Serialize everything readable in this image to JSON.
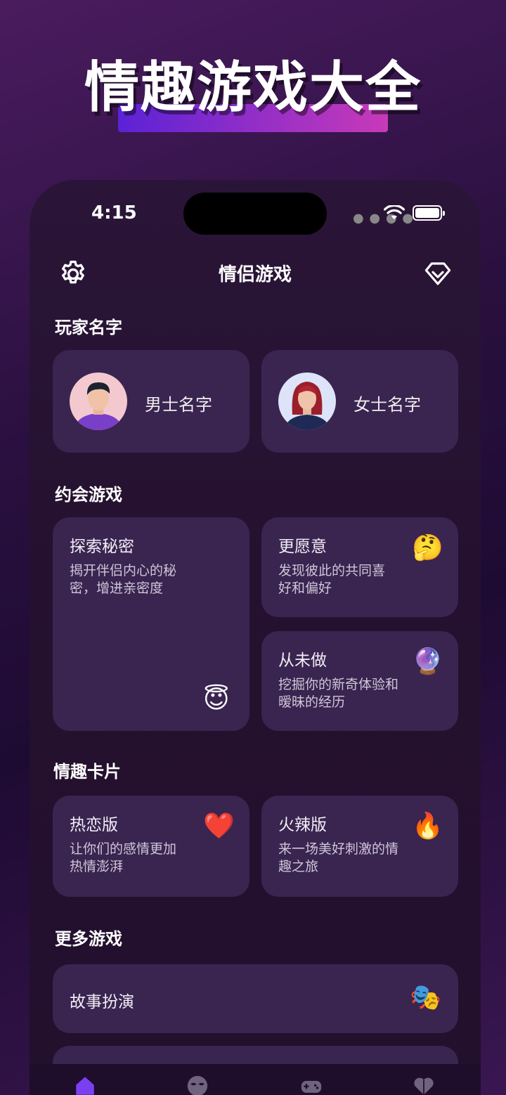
{
  "banner": {
    "title": "情趣游戏大全"
  },
  "status_bar": {
    "time": "4:15"
  },
  "nav": {
    "title": "情侣游戏",
    "left_icon": "gear-icon",
    "right_icon": "diamond-icon"
  },
  "players": {
    "heading": "玩家名字",
    "male_label": "男士名字",
    "female_label": "女士名字"
  },
  "date_games": {
    "heading": "约会游戏",
    "items": [
      {
        "title": "探索秘密",
        "desc_line1": "揭开伴侣内心的秘",
        "desc_line2": "密，增进亲密度",
        "emoji": "😇"
      },
      {
        "title": "更愿意",
        "desc_line1": "发现彼此的共同喜",
        "desc_line2": "好和偏好",
        "emoji": "🤔"
      },
      {
        "title": "从未做",
        "desc_line1": "挖掘你的新奇体验和",
        "desc_line2": "暧昧的经历",
        "emoji": "🔮"
      }
    ]
  },
  "cards": {
    "heading": "情趣卡片",
    "items": [
      {
        "title": "热恋版",
        "desc_line1": "让你们的感情更加",
        "desc_line2": "热情澎湃",
        "emoji": "❤️"
      },
      {
        "title": "火辣版",
        "desc_line1": "来一场美好刺激的情",
        "desc_line2": "趣之旅",
        "emoji": "🔥"
      }
    ]
  },
  "more_games": {
    "heading": "更多游戏",
    "items": [
      {
        "title": "故事扮演",
        "emoji": "🎭"
      }
    ]
  },
  "tabbar": {
    "tabs": [
      "home-icon",
      "mask-icon",
      "gamepad-icon",
      "heart-icon"
    ],
    "active_color": "#7b3ff2",
    "inactive_color": "#6f6380"
  }
}
